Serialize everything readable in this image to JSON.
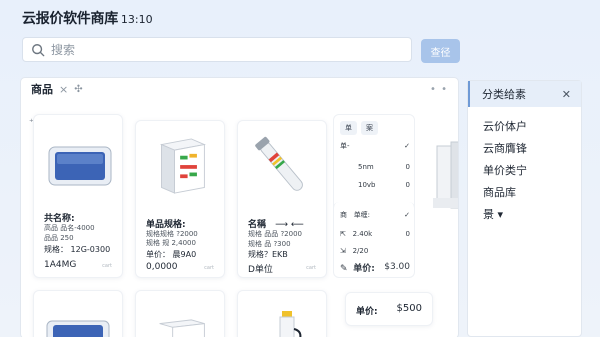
{
  "header": {
    "title": "云报价软件商库",
    "time": "13:10"
  },
  "search": {
    "placeholder": "搜索",
    "button": "查径"
  },
  "main": {
    "tab_label": "商品",
    "close_glyph": "×",
    "pin_glyph": "✣",
    "more_glyph": "• •",
    "toolbar_glyphs": "⁺ ⊘ ⋯"
  },
  "cards": [
    {
      "name": "共名称:",
      "line1": "高品 品名-4000",
      "line2": "品品 250",
      "spec": "规格： 12G-0300",
      "price": "1A4MG",
      "tag": "cart"
    },
    {
      "name": "单品规格:",
      "line1": "规格规格 ?2000",
      "line2": "规格 规 2,4000",
      "spec": "单价： 晨9A0",
      "price": "0,0000",
      "tag": "cart"
    },
    {
      "name": "名稱",
      "line1": "规格 品品 ?2000",
      "line2": "规格 品 ?300",
      "spec": "规格？EKB",
      "price": "D单位",
      "tag": "cart",
      "arrows": "⟶ ⟵"
    }
  ],
  "options": {
    "tabs": [
      "单",
      "案"
    ],
    "rows": [
      {
        "label": "单-",
        "value": "✓"
      },
      {
        "label": "5nm",
        "value": "0"
      },
      {
        "label": "10vb",
        "value": "0"
      }
    ],
    "rows2": [
      {
        "label": "单缠:",
        "value": "✓"
      },
      {
        "label": "2.40k",
        "value": "0"
      },
      {
        "label": "2/20",
        "value": ""
      }
    ],
    "side_icons": [
      "商",
      "⇱",
      "⇲",
      "✎"
    ],
    "price_label": "单价:",
    "price_value": "$3.00"
  },
  "price_card": {
    "label": "单价:",
    "value": "$500"
  },
  "sidebar": {
    "title": "分类给素",
    "close_glyph": "✕",
    "items": [
      "云价体户",
      "云商膺锋",
      "单价类宁",
      "商品库",
      "景 ▾"
    ]
  }
}
